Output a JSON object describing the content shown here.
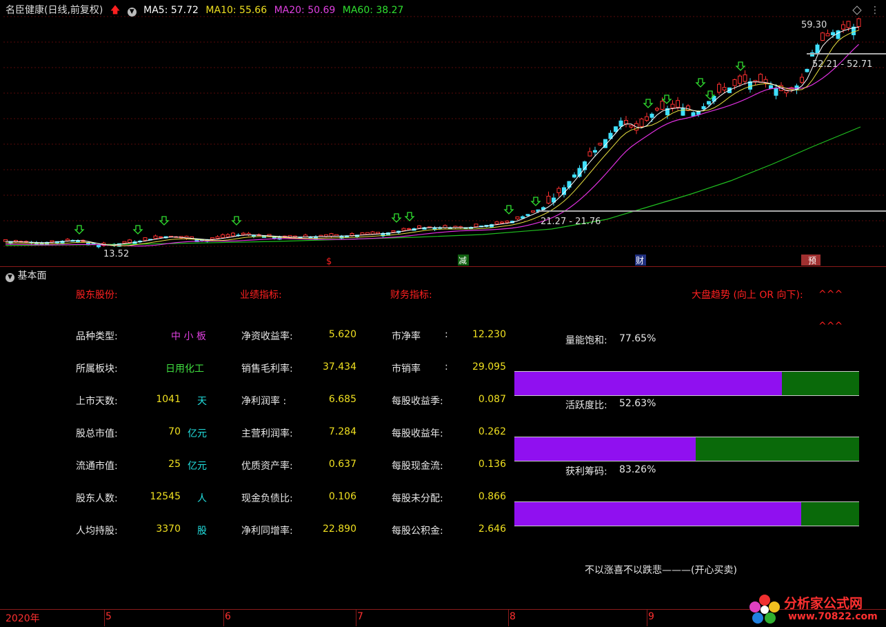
{
  "header": {
    "stock_name": "名臣健康(日线,前复权)",
    "ma5": "MA5: 57.72",
    "ma10": "MA10: 55.66",
    "ma20": "MA20: 50.69",
    "ma60": "MA60: 38.27"
  },
  "chart_annotations": {
    "high_price": "59.30",
    "low_price": "13.52",
    "range_upper": "52.21 - 52.71",
    "range_lower": "21.27 - 21.76",
    "event_s": "$",
    "event_jian": "减",
    "event_cai": "财",
    "event_yu": "预"
  },
  "colors": {
    "ma5": "#ffffff",
    "ma10": "#ffff40",
    "ma20": "#ff40ff",
    "ma60": "#20c020",
    "up": "#ff3030",
    "down": "#40e0ff"
  },
  "fundamentals": {
    "title": "基本面",
    "sec1": "股东股份:",
    "sec2": "业绩指标:",
    "sec3": "财务指标:",
    "market_trend": "大盘趋势 (向上 OR 向下):",
    "trend1": "^^^",
    "trend2": "^^^",
    "col1": [
      {
        "label": "品种类型:",
        "value": "中 小 板",
        "unit": ""
      },
      {
        "label": "所属板块:",
        "value": "日用化工",
        "unit": ""
      },
      {
        "label": "上市天数:",
        "value": "1041",
        "unit": "天"
      },
      {
        "label": "股总市值:",
        "value": "70",
        "unit": "亿元"
      },
      {
        "label": "流通市值:",
        "value": "25",
        "unit": "亿元"
      },
      {
        "label": "股东人数:",
        "value": "12545",
        "unit": "人"
      },
      {
        "label": "人均持股:",
        "value": "3370",
        "unit": "股"
      }
    ],
    "col2": [
      {
        "label": "净资收益率:",
        "value": "5.620"
      },
      {
        "label": "销售毛利率:",
        "value": "37.434"
      },
      {
        "label": "净利润率 :",
        "value": "6.685"
      },
      {
        "label": "主营利润率:",
        "value": "7.284"
      },
      {
        "label": "优质资产率:",
        "value": "0.637"
      },
      {
        "label": "现金负债比:",
        "value": "0.106"
      },
      {
        "label": "净利同增率:",
        "value": "22.890"
      }
    ],
    "col3": [
      {
        "label": "市净率",
        "sep": ":",
        "value": "12.230"
      },
      {
        "label": "市销率",
        "sep": ":",
        "value": "29.095"
      },
      {
        "label": "每股收益季:",
        "sep": "",
        "value": "0.087"
      },
      {
        "label": "每股收益年:",
        "sep": "",
        "value": "0.262"
      },
      {
        "label": "每股现金流:",
        "sep": "",
        "value": "0.136"
      },
      {
        "label": "每股未分配:",
        "sep": "",
        "value": "0.866"
      },
      {
        "label": "每股公积金:",
        "sep": "",
        "value": "2.646"
      }
    ],
    "bars": [
      {
        "label": "量能饱和:",
        "value": "77.65%",
        "fraction": 0.7765
      },
      {
        "label": "活跃度比:",
        "value": "52.63%",
        "fraction": 0.5263
      },
      {
        "label": "获利筹码:",
        "value": "83.26%",
        "fraction": 0.8326
      }
    ],
    "motto": "不以涨喜不以跌悲———(开心买卖)"
  },
  "time_axis": [
    "2020年",
    "5",
    "6",
    "7",
    "8",
    "9"
  ],
  "watermark": {
    "name": "分析家公式网",
    "url": "www.70822.com"
  }
}
